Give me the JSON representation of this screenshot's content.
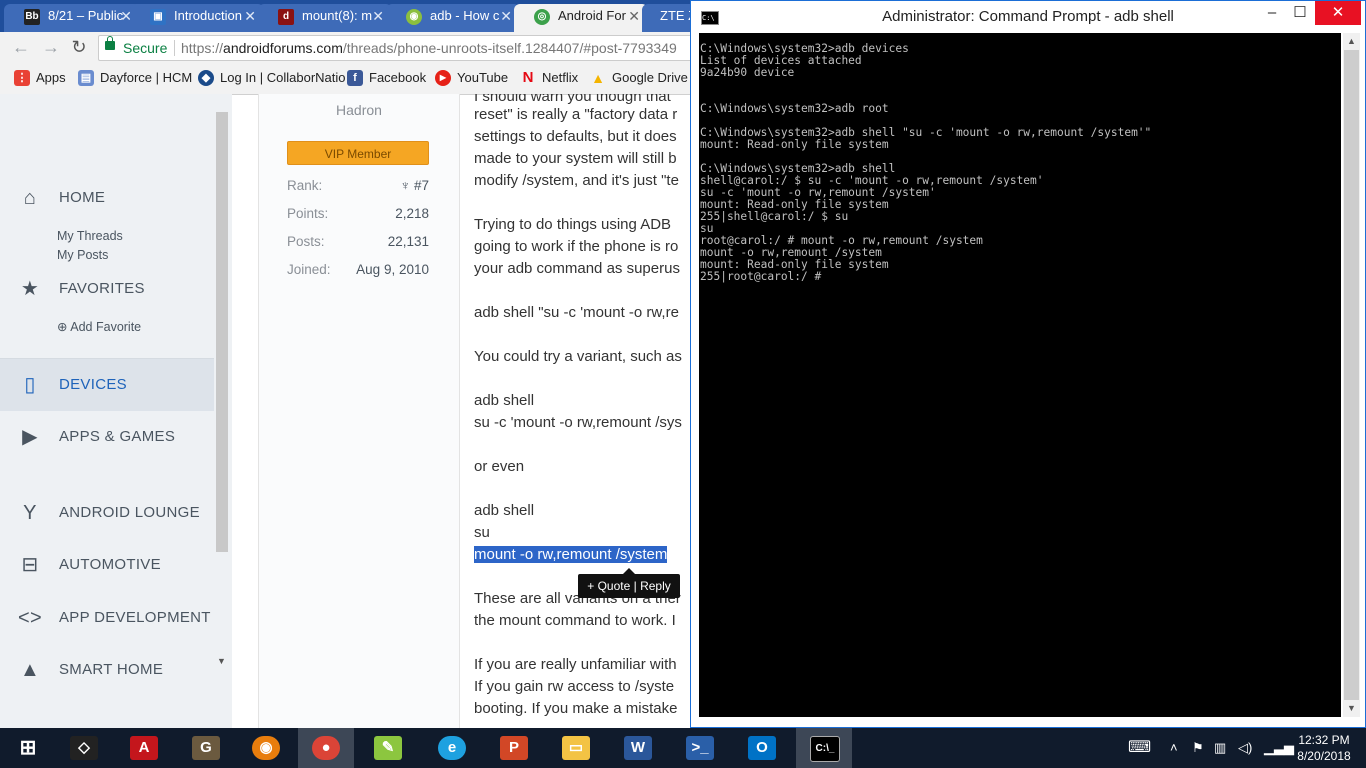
{
  "browser": {
    "tabs": [
      {
        "label": "8/21 – Public",
        "icon": "blackboard-icon"
      },
      {
        "label": "Introduction",
        "icon": "doc-icon"
      },
      {
        "label": "mount(8): m",
        "icon": "die-icon"
      },
      {
        "label": "adb - How c",
        "icon": "android-icon"
      },
      {
        "label": "Android For",
        "icon": "chrome-icon"
      },
      {
        "label": "ZTE Z",
        "icon": "zte-icon"
      }
    ],
    "secure_label": "Secure",
    "url_prefix": "https://",
    "url_domain": "androidforums.com",
    "url_path": "/threads/phone-unroots-itself.1284407/#post-7793349",
    "bookmarks": [
      {
        "label": "Apps",
        "icon": "apps-grid-icon",
        "color": "#e94235"
      },
      {
        "label": "Dayforce | HCM",
        "icon": "dayforce-icon",
        "color": "#6a8ccf"
      },
      {
        "label": "Log In | CollaborNatio",
        "icon": "collabor-icon",
        "color": "#1b4b8a"
      },
      {
        "label": "Facebook",
        "icon": "facebook-icon",
        "color": "#3b5998"
      },
      {
        "label": "YouTube",
        "icon": "youtube-icon",
        "color": "#e62117"
      },
      {
        "label": "Netflix",
        "icon": "netflix-icon",
        "color": "#e50914"
      },
      {
        "label": "Google Drive",
        "icon": "drive-icon",
        "color": "#f4b400"
      }
    ]
  },
  "sidebar": {
    "home": "HOME",
    "my_threads": "My Threads",
    "my_posts": "My Posts",
    "favorites": "FAVORITES",
    "add_favorite": "Add Favorite",
    "devices": "DEVICES",
    "apps_games": "APPS & GAMES",
    "android_lounge": "ANDROID LOUNGE",
    "automotive": "AUTOMOTIVE",
    "app_development": "APP DEVELOPMENT",
    "smart_home": "SMART HOME"
  },
  "user": {
    "title": "Hadron",
    "badge": "VIP Member",
    "rank_label": "Rank:",
    "rank_value": "#7",
    "points_label": "Points:",
    "points_value": "2,218",
    "posts_label": "Posts:",
    "posts_value": "22,131",
    "joined_label": "Joined:",
    "joined_value": "Aug 9, 2010"
  },
  "post": {
    "lines": [
      "I should warn you though that",
      "reset\" is really a \"factory data r",
      "settings to defaults, but it does",
      "made to your system will still b",
      "modify /system, and it's just \"te",
      "Trying to do things using ADB",
      "going to work if the phone is ro",
      "your adb command as superus",
      "adb shell \"su -c 'mount -o rw,re",
      "You could try a variant, such as",
      "adb shell",
      "su -c 'mount -o rw,remount /sys",
      "or even",
      "adb shell",
      "su",
      "mount -o rw,remount /system",
      "These are all variants on a ther",
      "the mount command to work. I",
      "If you are really unfamiliar with",
      "If you gain rw access to /syste",
      "booting. If you make a mistake"
    ],
    "quote_reply": "+ Quote | Reply"
  },
  "cmd": {
    "title": "Administrator: Command Prompt - adb  shell",
    "console_text": "C:\\Windows\\system32>adb devices\nList of devices attached\n9a24b90 device\n\n\nC:\\Windows\\system32>adb root\n\nC:\\Windows\\system32>adb shell \"su -c 'mount -o rw,remount /system'\"\nmount: Read-only file system\n\nC:\\Windows\\system32>adb shell\nshell@carol:/ $ su -c 'mount -o rw,remount /system'\nsu -c 'mount -o rw,remount /system'\nmount: Read-only file system\n255|shell@carol:/ $ su\nsu\nroot@carol:/ # mount -o rw,remount /system\nmount -o rw,remount /system\nmount: Read-only file system\n255|root@carol:/ #",
    "minimize": "–",
    "maximize": "☐",
    "close": "✕"
  },
  "taskbar": {
    "apps": [
      {
        "name": "start-button",
        "icon": "windows-logo-icon",
        "color": "#101b2c"
      },
      {
        "name": "unity",
        "icon": "unity-icon",
        "color": "#222222"
      },
      {
        "name": "acrobat",
        "icon": "acrobat-icon",
        "color": "#c4161c"
      },
      {
        "name": "gimp",
        "icon": "gimp-icon",
        "color": "#6b5a3f"
      },
      {
        "name": "blender",
        "icon": "blender-icon",
        "color": "#e87d0d"
      },
      {
        "name": "chrome",
        "icon": "chrome-icon",
        "color": "#db4437"
      },
      {
        "name": "notepadpp",
        "icon": "notepad-icon",
        "color": "#8cc63f"
      },
      {
        "name": "ie",
        "icon": "ie-icon",
        "color": "#1ea1e0"
      },
      {
        "name": "powerpoint",
        "icon": "powerpoint-icon",
        "color": "#d24726"
      },
      {
        "name": "explorer",
        "icon": "folder-icon",
        "color": "#f3c344"
      },
      {
        "name": "word",
        "icon": "word-icon",
        "color": "#2b579a"
      },
      {
        "name": "powershell",
        "icon": "powershell-icon",
        "color": "#2a5fa8"
      },
      {
        "name": "outlook",
        "icon": "outlook-icon",
        "color": "#0072c6"
      },
      {
        "name": "cmd",
        "icon": "cmd-icon",
        "color": "#000000"
      }
    ],
    "time": "12:32 PM",
    "date": "8/20/2018"
  }
}
